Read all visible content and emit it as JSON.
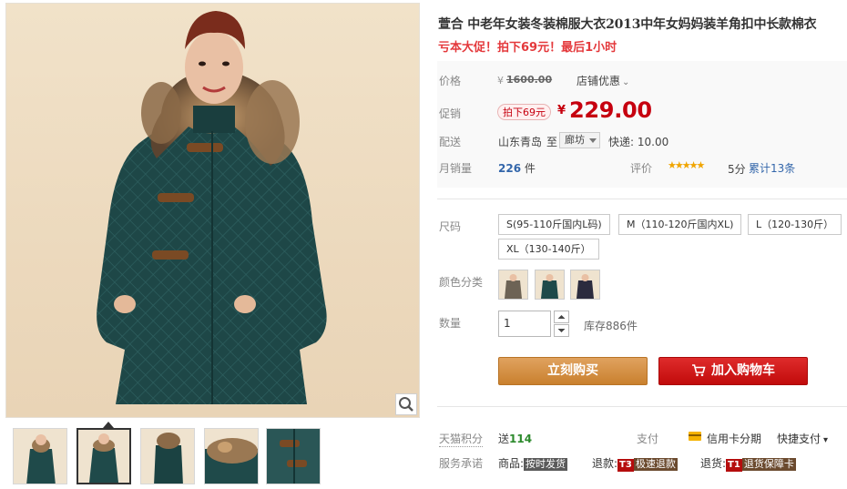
{
  "product": {
    "title": "萱合 中老年女装冬装棉服大衣2013中年女妈妈装羊角扣中长款棉衣",
    "subtitle": "亏本大促！拍下69元！最后1小时"
  },
  "price": {
    "label": "价格",
    "currency": "¥",
    "original": "1600.00",
    "shop_discount": "店铺优惠",
    "promo_label": "促销",
    "promo_tag": "拍下69元",
    "promo_price": "229.00"
  },
  "shipping": {
    "label": "配送",
    "from": "山东青岛",
    "to_word": "至",
    "city": "廊坊",
    "express": "快递: 10.00"
  },
  "sales": {
    "label": "月销量",
    "count": "226",
    "unit": "件",
    "rating_label": "评价",
    "stars": "★★★★★",
    "score": "5分",
    "total_reviews": "累计13条"
  },
  "size": {
    "label": "尺码",
    "options": [
      "S(95-110斤国内L码)",
      "M（110-120斤国内XL)",
      "L（120-130斤）",
      "XL（130-140斤）"
    ]
  },
  "color": {
    "label": "颜色分类"
  },
  "quantity": {
    "label": "数量",
    "value": "1",
    "stock": "库存886件"
  },
  "actions": {
    "buy_now": "立刻购买",
    "add_cart": "加入购物车"
  },
  "points": {
    "label": "天猫积分",
    "send": "送",
    "value": "114"
  },
  "payment": {
    "label": "支付",
    "credit": "信用卡分期",
    "quick": "快捷支付",
    "quick_arrow": "▾"
  },
  "service": {
    "label": "服务承诺",
    "goods": "商品:",
    "goods_tag": "按时发货",
    "refund": "退款:",
    "refund_code": "T3",
    "refund_tag": "极速退款",
    "return": "退货:",
    "return_code": "T1",
    "return_tag": "退货保障卡"
  },
  "colors": {
    "accent_red": "#c6000f",
    "buy_orange": "#d18b3c",
    "coat_green": "#1f4a4a"
  }
}
